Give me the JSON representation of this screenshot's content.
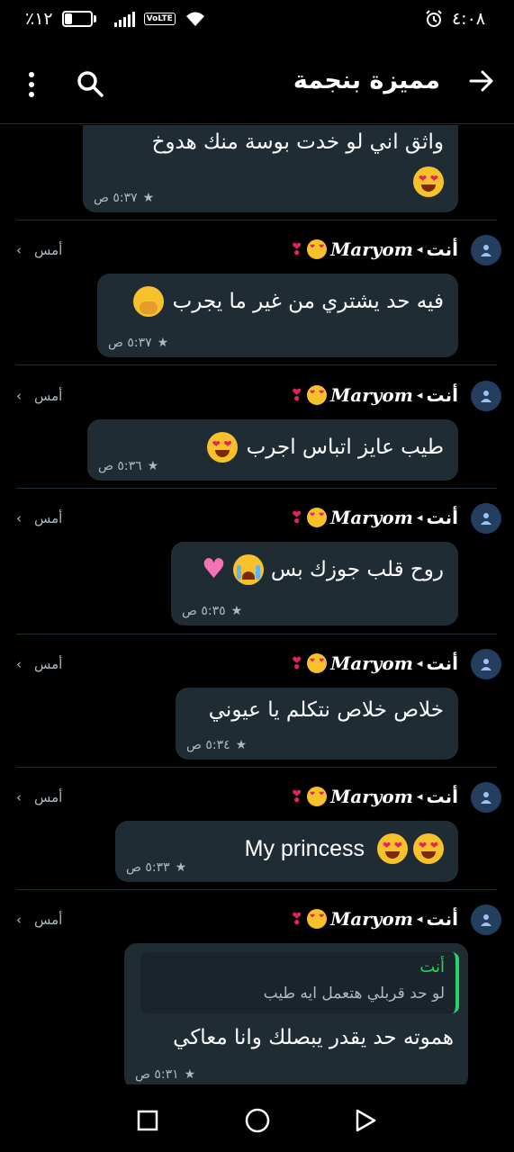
{
  "status_bar": {
    "battery": "٪١٢",
    "volte": "VoLTE",
    "time": "٤:٠٨"
  },
  "header": {
    "title": "مميزة بنجمة",
    "back_icon": "arrow-right-icon",
    "search_icon": "search-icon",
    "menu_icon": "more-vert-icon"
  },
  "messages": [
    {
      "text": "واثق اني لو خدت بوسة منك هدوخ",
      "time": "٥:٣٧ ص",
      "emoji": "heart-eyes"
    },
    {
      "sender_you": "أنت",
      "sender_name": "Maryom",
      "day": "أمس",
      "text": "فيه حد يشتري من غير ما يجرب",
      "time": "٥:٣٧ ص",
      "emoji": "hand-over-mouth"
    },
    {
      "sender_you": "أنت",
      "sender_name": "Maryom",
      "day": "أمس",
      "text": "طيب عايز اتباس اجرب",
      "time": "٥:٣٦ ص",
      "emoji": "heart-eyes"
    },
    {
      "sender_you": "أنت",
      "sender_name": "Maryom",
      "day": "أمس",
      "text": "روح قلب جوزك بس",
      "time": "٥:٣٥ ص",
      "emoji": "crying-and-pink-heart"
    },
    {
      "sender_you": "أنت",
      "sender_name": "Maryom",
      "day": "أمس",
      "text": "خلاص خلاص نتكلم يا عيوني",
      "time": "٥:٣٤ ص"
    },
    {
      "sender_you": "أنت",
      "sender_name": "Maryom",
      "day": "أمس",
      "text": "My princess",
      "time": "٥:٣٣ ص",
      "emoji": "two-heart-eyes"
    },
    {
      "sender_you": "أنت",
      "sender_name": "Maryom",
      "day": "أمس",
      "quote_author": "أنت",
      "quote_text": "لو حد قربلي هتعمل ايه طيب",
      "text": "هموته حد يقدر يبصلك وانا معاكي",
      "time": "٥:٣١ ص"
    }
  ],
  "navbar": {
    "recents_icon": "square-icon",
    "home_icon": "circle-icon",
    "back_icon": "triangle-back-icon"
  }
}
